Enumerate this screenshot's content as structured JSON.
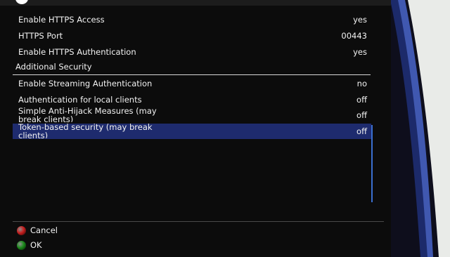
{
  "settings": [
    {
      "label": "Enable HTTPS Access",
      "value": "yes"
    },
    {
      "label": "HTTPS Port",
      "value": "00443"
    },
    {
      "label": "Enable HTTPS Authentication",
      "value": "yes"
    }
  ],
  "section": {
    "title": "Additional Security"
  },
  "security_settings": [
    {
      "label": "Enable Streaming Authentication",
      "value": "no"
    },
    {
      "label": "Authentication for local clients",
      "value": "off"
    },
    {
      "label": "Simple Anti-Hijack Measures (may break clients)",
      "value": "off"
    },
    {
      "label": "Token-based security (may break clients)",
      "value": "off"
    }
  ],
  "keys": {
    "cancel": {
      "label": "Cancel",
      "color": "#c81e1e",
      "icon": "red-button-icon"
    },
    "ok": {
      "label": "OK",
      "color": "#1a8a1a",
      "icon": "green-button-icon"
    }
  },
  "colors": {
    "panel_background": "#0c0c0c",
    "selection": "#1e2b6e",
    "text": "#f2f2f2",
    "swoosh_blue": "#1c2a6a"
  }
}
